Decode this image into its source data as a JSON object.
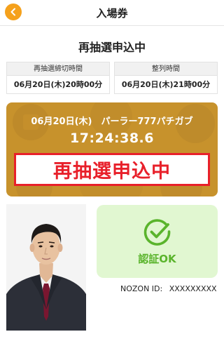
{
  "header": {
    "title": "入場券"
  },
  "status": {
    "heading": "再抽選申込中"
  },
  "info": {
    "deadline": {
      "label": "再抽選締切時間",
      "value": "06月20日(木)20時00分"
    },
    "lineup": {
      "label": "整列時間",
      "value": "06月20日(木)21時00分"
    }
  },
  "ticket": {
    "date_venue": "06月20日(木)　パーラー777パチガブ",
    "clock": "17:24:38.6",
    "banner": "再抽選申込中",
    "card_color": "#c7922c",
    "banner_color": "#e8202a"
  },
  "auth": {
    "icon": "check-circle-icon",
    "text": "認証OK",
    "color": "#5ab42c"
  },
  "member": {
    "id_label": "NOZON ID:",
    "id_value": "XXXXXXXXX"
  },
  "colors": {
    "accent": "#f5a11c"
  }
}
